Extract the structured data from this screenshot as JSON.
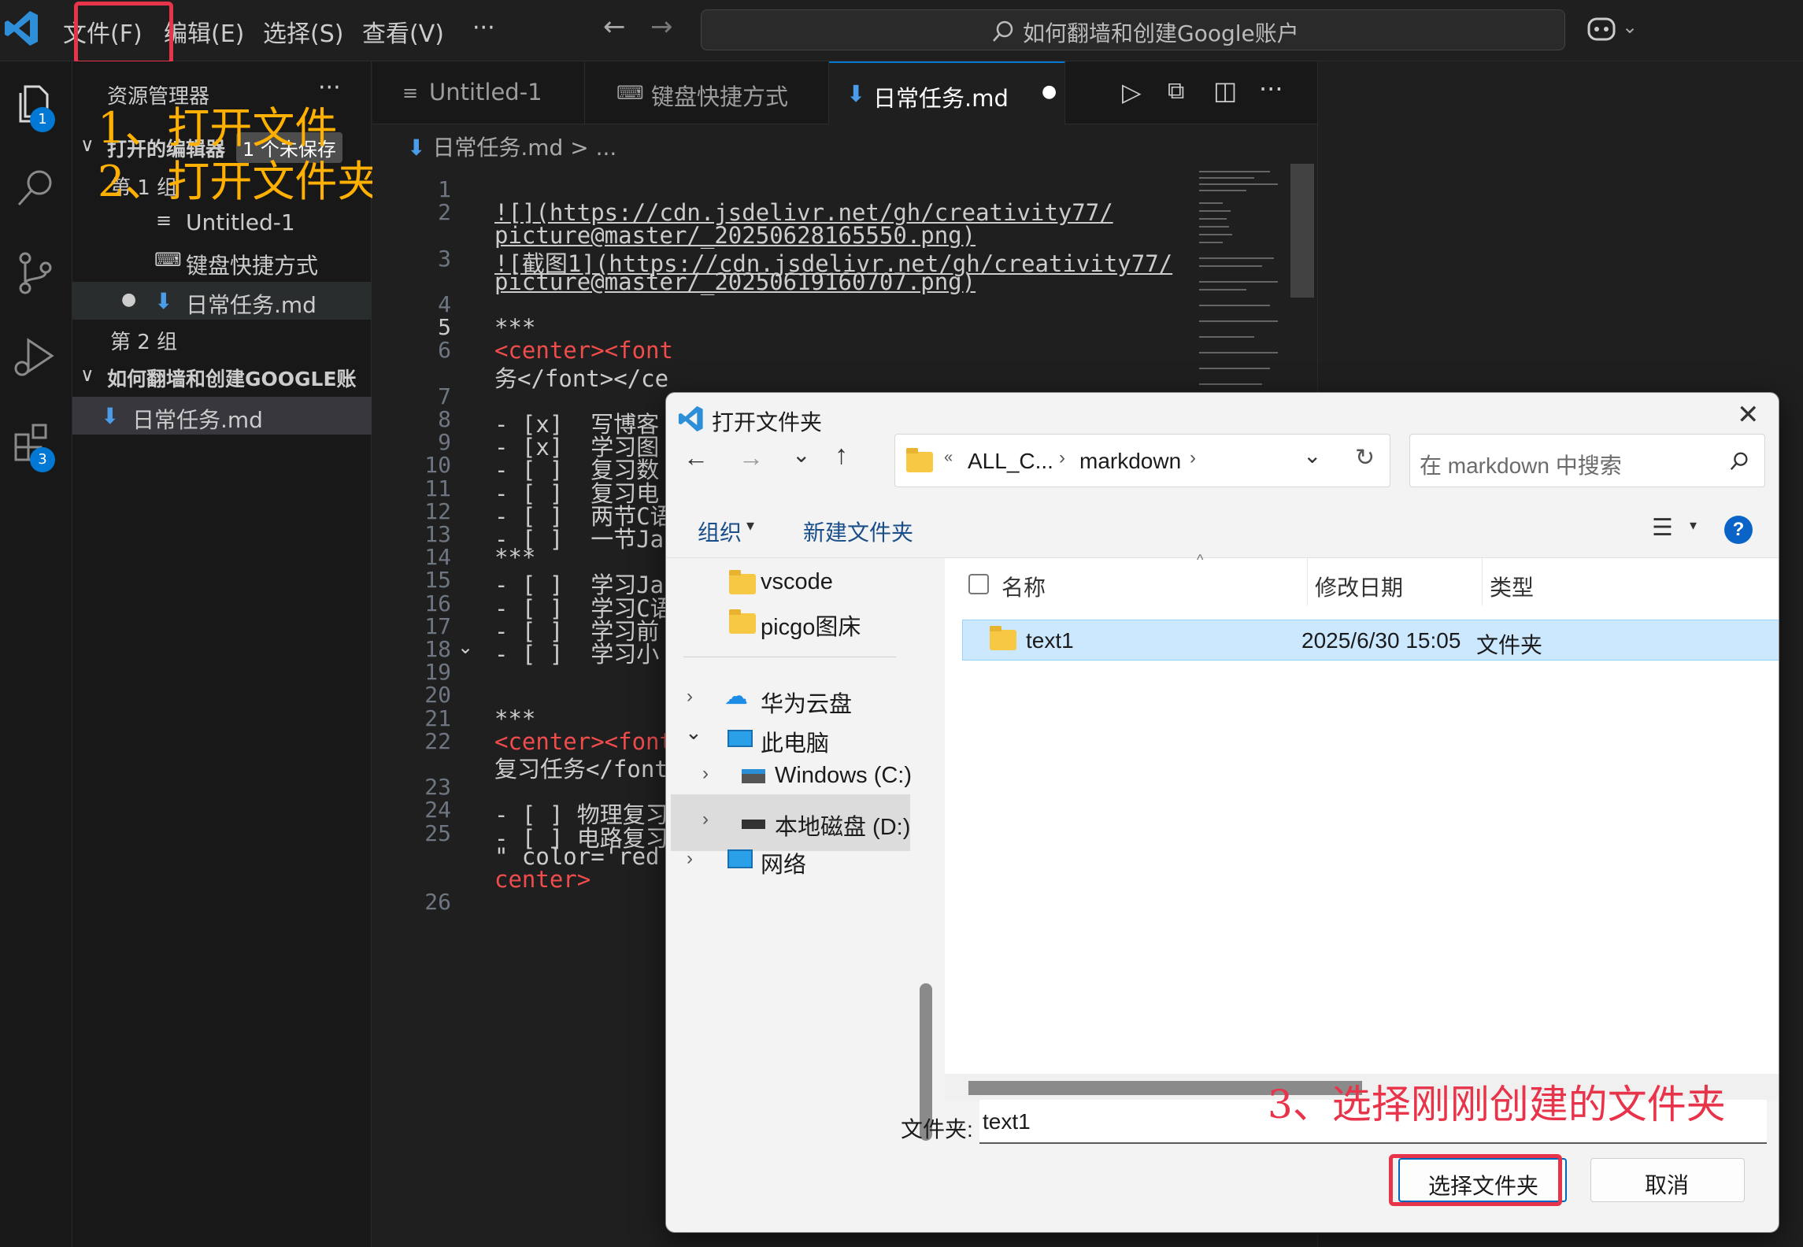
{
  "menu": {
    "file": "文件(F)",
    "edit": "编辑(E)",
    "select": "选择(S)",
    "view": "查看(V)",
    "more": "···"
  },
  "title_search": "如何翻墙和创建Google账户",
  "activity_badges": {
    "explorer": "1",
    "extensions": "3"
  },
  "sidebar": {
    "title": "资源管理器",
    "open_editors": "打开的编辑器",
    "unsaved_badge": "1 个未保存",
    "group1": "第 1 组",
    "group1_items": [
      "Untitled-1",
      "键盘快捷方式",
      "日常任务.md"
    ],
    "group2": "第 2 组",
    "folder": "如何翻墙和创建GOOGLE账户",
    "folder_items": [
      "日常任务.md"
    ]
  },
  "annotations": {
    "step1": "1、打开文件",
    "step2": "2、打开文件夹",
    "step3": "3、选择刚刚创建的文件夹"
  },
  "tabs": [
    "Untitled-1",
    "键盘快捷方式",
    "日常任务.md"
  ],
  "breadcrumb": {
    "file": "日常任务.md",
    "sep": ">",
    "more": "..."
  },
  "editor_lines": [
    {
      "n": "1",
      "t": ""
    },
    {
      "n": "2",
      "t": "![](https://cdn.jsdelivr.net/gh/creativity77/"
    },
    {
      "n": "",
      "t": "picture@master/_20250628165550.png)"
    },
    {
      "n": "3",
      "t": "![截图1](https://cdn.jsdelivr.net/gh/creativity77/"
    },
    {
      "n": "",
      "t": "picture@master/_20250619160707.png)"
    },
    {
      "n": "4",
      "t": ""
    },
    {
      "n": "5",
      "t": "***"
    },
    {
      "n": "6",
      "t": "<center><font"
    },
    {
      "n": "",
      "t": "务</font></ce"
    },
    {
      "n": "7",
      "t": ""
    },
    {
      "n": "8",
      "t": "- [x]  写博客"
    },
    {
      "n": "9",
      "t": "- [x]  学习图"
    },
    {
      "n": "10",
      "t": "- [ ]  复习数"
    },
    {
      "n": "11",
      "t": "- [ ]  复习电"
    },
    {
      "n": "12",
      "t": "- [ ]  两节C语"
    },
    {
      "n": "13",
      "t": "- [ ]  一节Ja"
    },
    {
      "n": "14",
      "t": "***"
    },
    {
      "n": "15",
      "t": "- [ ]  学习Ja"
    },
    {
      "n": "16",
      "t": "- [ ]  学习C语"
    },
    {
      "n": "17",
      "t": "- [ ]  学习前"
    },
    {
      "n": "18",
      "t": "- [ ]  学习小"
    },
    {
      "n": "19",
      "t": ""
    },
    {
      "n": "20",
      "t": ""
    },
    {
      "n": "21",
      "t": "***"
    },
    {
      "n": "22",
      "t": "<center><font"
    },
    {
      "n": "",
      "t": "复习任务</font"
    },
    {
      "n": "23",
      "t": ""
    },
    {
      "n": "24",
      "t": "- [ ] 物理复习"
    },
    {
      "n": "25",
      "t": "- [ ] 电路复习"
    },
    {
      "n": "",
      "t": "\" color='red'"
    },
    {
      "n": "",
      "t": "center>"
    },
    {
      "n": "26",
      "t": ""
    }
  ],
  "dialog": {
    "title": "打开文件夹",
    "path": [
      "ALL_C...",
      "markdown"
    ],
    "search_placeholder": "在 markdown 中搜索",
    "toolbar": {
      "organize": "组织",
      "new_folder": "新建文件夹"
    },
    "nav": [
      "vscode",
      "picgo图床",
      "华为云盘",
      "此电脑",
      "Windows (C:)",
      "本地磁盘 (D:)",
      "网络"
    ],
    "columns": {
      "name": "名称",
      "modified": "修改日期",
      "type": "类型"
    },
    "rows": [
      {
        "name": "text1",
        "modified": "2025/6/30 15:05",
        "type": "文件夹"
      }
    ],
    "folder_label": "文件夹:",
    "folder_value": "text1",
    "select_button": "选择文件夹",
    "cancel_button": "取消"
  }
}
